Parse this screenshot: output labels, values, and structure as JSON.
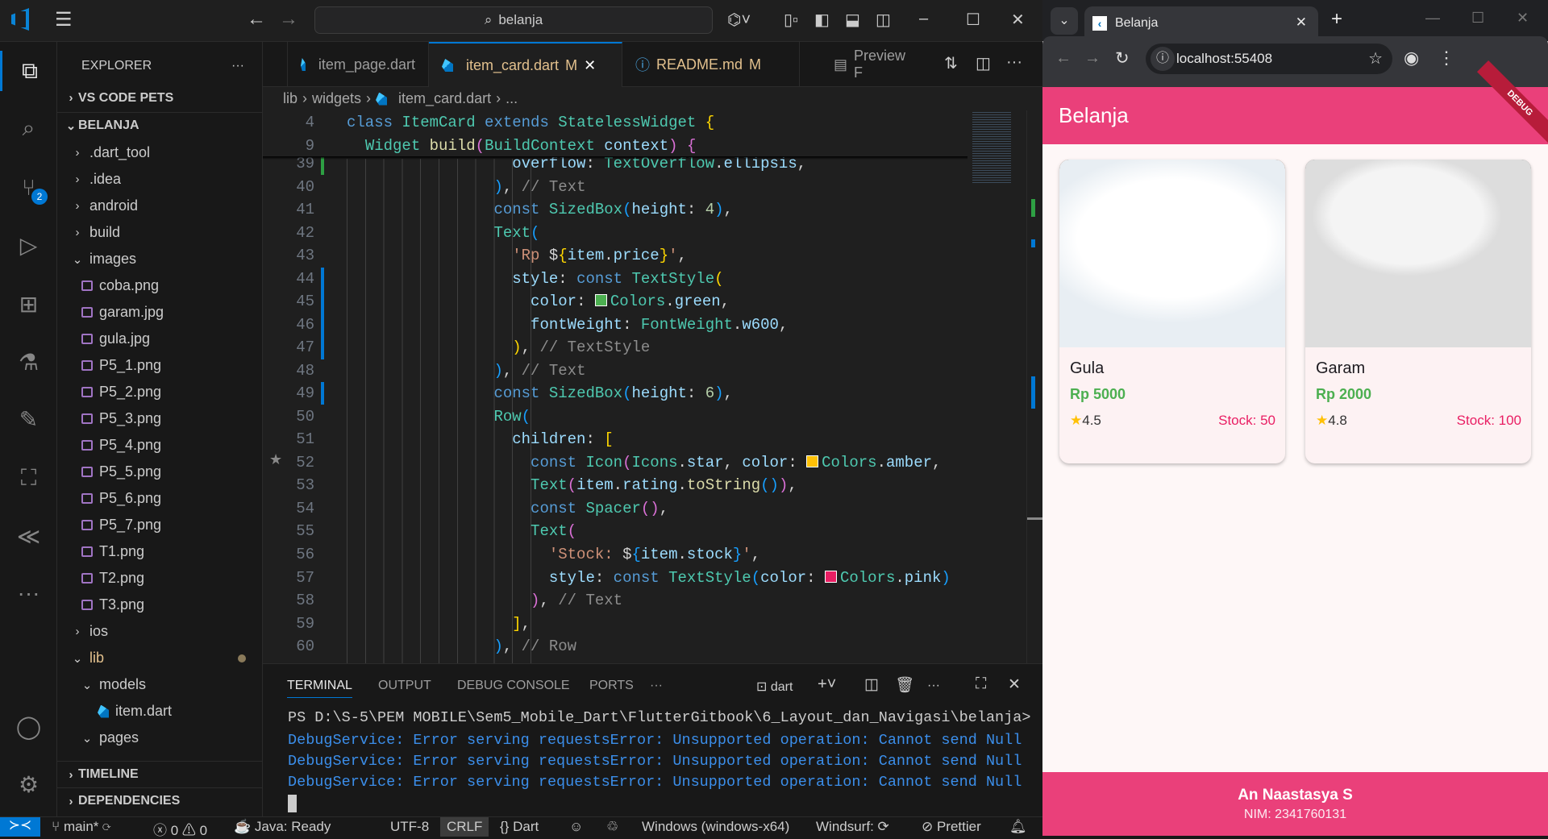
{
  "titlebar": {
    "search": "belanja",
    "nav_back": "←",
    "nav_forward": "→",
    "menu": "☰"
  },
  "activity": {
    "scm_badge": "2"
  },
  "sidebar": {
    "title": "EXPLORER",
    "more": "···",
    "sections": {
      "pets": "VS CODE PETS",
      "project": "BELANJA",
      "timeline": "TIMELINE",
      "dependencies": "DEPENDENCIES"
    },
    "tree": [
      {
        "label": ".dart_tool",
        "kind": "folder",
        "depth": 0,
        "open": false
      },
      {
        "label": ".idea",
        "kind": "folder",
        "depth": 0,
        "open": false
      },
      {
        "label": "android",
        "kind": "folder",
        "depth": 0,
        "open": false
      },
      {
        "label": "build",
        "kind": "folder",
        "depth": 0,
        "open": false
      },
      {
        "label": "images",
        "kind": "folder",
        "depth": 0,
        "open": true
      },
      {
        "label": "coba.png",
        "kind": "image",
        "depth": 1
      },
      {
        "label": "garam.jpg",
        "kind": "image",
        "depth": 1
      },
      {
        "label": "gula.jpg",
        "kind": "image",
        "depth": 1
      },
      {
        "label": "P5_1.png",
        "kind": "image",
        "depth": 1
      },
      {
        "label": "P5_2.png",
        "kind": "image",
        "depth": 1
      },
      {
        "label": "P5_3.png",
        "kind": "image",
        "depth": 1
      },
      {
        "label": "P5_4.png",
        "kind": "image",
        "depth": 1
      },
      {
        "label": "P5_5.png",
        "kind": "image",
        "depth": 1
      },
      {
        "label": "P5_6.png",
        "kind": "image",
        "depth": 1
      },
      {
        "label": "P5_7.png",
        "kind": "image",
        "depth": 1
      },
      {
        "label": "T1.png",
        "kind": "image",
        "depth": 1
      },
      {
        "label": "T2.png",
        "kind": "image",
        "depth": 1
      },
      {
        "label": "T3.png",
        "kind": "image",
        "depth": 1
      },
      {
        "label": "ios",
        "kind": "folder",
        "depth": 0,
        "open": false
      },
      {
        "label": "lib",
        "kind": "folder",
        "depth": 0,
        "open": true,
        "modified": true
      },
      {
        "label": "models",
        "kind": "folder",
        "depth": 1,
        "open": true
      },
      {
        "label": "item.dart",
        "kind": "dart",
        "depth": 2
      },
      {
        "label": "pages",
        "kind": "folder",
        "depth": 1,
        "open": true
      }
    ]
  },
  "editor": {
    "tabs": [
      {
        "label": "item_page.dart",
        "status": "",
        "icon": "dart"
      },
      {
        "label": "item_card.dart",
        "status": "M",
        "icon": "dart",
        "active": true
      },
      {
        "label": "README.md",
        "status": "M",
        "icon": "info"
      },
      {
        "label": "Preview F",
        "status": "",
        "icon": "preview"
      }
    ],
    "breadcrumb": [
      "lib",
      "widgets",
      "item_card.dart",
      "..."
    ],
    "sticky": [
      {
        "n": "4",
        "tokens": [
          [
            "kw",
            "class "
          ],
          [
            "cls",
            "ItemCard "
          ],
          [
            "kw",
            "extends "
          ],
          [
            "cls",
            "StatelessWidget "
          ],
          [
            "b1",
            "{"
          ]
        ]
      },
      {
        "n": "9",
        "tokens": [
          [
            "p",
            "  "
          ],
          [
            "cls",
            "Widget "
          ],
          [
            "fn",
            "build"
          ],
          [
            "b2",
            "("
          ],
          [
            "cls",
            "BuildContext "
          ],
          [
            "prop",
            "context"
          ],
          [
            "b2",
            ")"
          ],
          [
            "p",
            " "
          ],
          [
            "b2",
            "{"
          ]
        ]
      }
    ],
    "lines": [
      {
        "n": "39",
        "tokens": [
          [
            "p",
            "                  "
          ],
          [
            "prop",
            "overflow"
          ],
          [
            "p",
            ": "
          ],
          [
            "cls",
            "TextOverflow"
          ],
          [
            "p",
            "."
          ],
          [
            "prop",
            "ellipsis"
          ],
          [
            "p",
            ","
          ]
        ]
      },
      {
        "n": "40",
        "tokens": [
          [
            "p",
            "                "
          ],
          [
            "b3",
            ")"
          ],
          [
            "p",
            ", "
          ],
          [
            "cm",
            "// Text"
          ]
        ]
      },
      {
        "n": "41",
        "tokens": [
          [
            "p",
            "                "
          ],
          [
            "kw",
            "const "
          ],
          [
            "cls",
            "SizedBox"
          ],
          [
            "b3",
            "("
          ],
          [
            "prop",
            "height"
          ],
          [
            "p",
            ": "
          ],
          [
            "num",
            "4"
          ],
          [
            "b3",
            ")"
          ],
          [
            "p",
            ","
          ]
        ]
      },
      {
        "n": "42",
        "tokens": [
          [
            "p",
            "                "
          ],
          [
            "cls",
            "Text"
          ],
          [
            "b3",
            "("
          ]
        ]
      },
      {
        "n": "43",
        "tokens": [
          [
            "p",
            "                  "
          ],
          [
            "str",
            "'Rp "
          ],
          [
            "p",
            "$"
          ],
          [
            "b1",
            "{"
          ],
          [
            "prop",
            "item"
          ],
          [
            "p",
            "."
          ],
          [
            "prop",
            "price"
          ],
          [
            "b1",
            "}"
          ],
          [
            "str",
            "'"
          ],
          [
            "p",
            ","
          ]
        ]
      },
      {
        "n": "44",
        "tokens": [
          [
            "p",
            "                  "
          ],
          [
            "prop",
            "style"
          ],
          [
            "p",
            ": "
          ],
          [
            "kw",
            "const "
          ],
          [
            "cls",
            "TextStyle"
          ],
          [
            "b1",
            "("
          ]
        ]
      },
      {
        "n": "45",
        "tokens": [
          [
            "p",
            "                    "
          ],
          [
            "prop",
            "color"
          ],
          [
            "p",
            ": "
          ],
          [
            "sw",
            "#4caf50"
          ],
          [
            "cls",
            "Colors"
          ],
          [
            "p",
            "."
          ],
          [
            "prop",
            "green"
          ],
          [
            "p",
            ","
          ]
        ]
      },
      {
        "n": "46",
        "tokens": [
          [
            "p",
            "                    "
          ],
          [
            "prop",
            "fontWeight"
          ],
          [
            "p",
            ": "
          ],
          [
            "cls",
            "FontWeight"
          ],
          [
            "p",
            "."
          ],
          [
            "prop",
            "w600"
          ],
          [
            "p",
            ","
          ]
        ]
      },
      {
        "n": "47",
        "tokens": [
          [
            "p",
            "                  "
          ],
          [
            "b1",
            ")"
          ],
          [
            "p",
            ", "
          ],
          [
            "cm",
            "// TextStyle"
          ]
        ]
      },
      {
        "n": "48",
        "tokens": [
          [
            "p",
            "                "
          ],
          [
            "b3",
            ")"
          ],
          [
            "p",
            ", "
          ],
          [
            "cm",
            "// Text"
          ]
        ]
      },
      {
        "n": "49",
        "tokens": [
          [
            "p",
            "                "
          ],
          [
            "kw",
            "const "
          ],
          [
            "cls",
            "SizedBox"
          ],
          [
            "b3",
            "("
          ],
          [
            "prop",
            "height"
          ],
          [
            "p",
            ": "
          ],
          [
            "num",
            "6"
          ],
          [
            "b3",
            ")"
          ],
          [
            "p",
            ","
          ]
        ]
      },
      {
        "n": "50",
        "tokens": [
          [
            "p",
            "                "
          ],
          [
            "cls",
            "Row"
          ],
          [
            "b3",
            "("
          ]
        ]
      },
      {
        "n": "51",
        "tokens": [
          [
            "p",
            "                  "
          ],
          [
            "prop",
            "children"
          ],
          [
            "p",
            ": "
          ],
          [
            "b1",
            "["
          ]
        ]
      },
      {
        "n": "52",
        "tokens": [
          [
            "p",
            "                    "
          ],
          [
            "kw",
            "const "
          ],
          [
            "cls",
            "Icon"
          ],
          [
            "b2",
            "("
          ],
          [
            "cls",
            "Icons"
          ],
          [
            "p",
            "."
          ],
          [
            "prop",
            "star"
          ],
          [
            "p",
            ", "
          ],
          [
            "prop",
            "color"
          ],
          [
            "p",
            ": "
          ],
          [
            "sw",
            "#ffc107"
          ],
          [
            "cls",
            "Colors"
          ],
          [
            "p",
            "."
          ],
          [
            "prop",
            "amber"
          ],
          [
            "p",
            ", "
          ]
        ]
      },
      {
        "n": "53",
        "tokens": [
          [
            "p",
            "                    "
          ],
          [
            "cls",
            "Text"
          ],
          [
            "b2",
            "("
          ],
          [
            "prop",
            "item"
          ],
          [
            "p",
            "."
          ],
          [
            "prop",
            "rating"
          ],
          [
            "p",
            "."
          ],
          [
            "fn",
            "toString"
          ],
          [
            "b3",
            "()"
          ],
          [
            "b2",
            ")"
          ],
          [
            "p",
            ","
          ]
        ]
      },
      {
        "n": "54",
        "tokens": [
          [
            "p",
            "                    "
          ],
          [
            "kw",
            "const "
          ],
          [
            "cls",
            "Spacer"
          ],
          [
            "b2",
            "()"
          ],
          [
            "p",
            ","
          ]
        ]
      },
      {
        "n": "55",
        "tokens": [
          [
            "p",
            "                    "
          ],
          [
            "cls",
            "Text"
          ],
          [
            "b2",
            "("
          ]
        ]
      },
      {
        "n": "56",
        "tokens": [
          [
            "p",
            "                      "
          ],
          [
            "str",
            "'Stock: "
          ],
          [
            "p",
            "$"
          ],
          [
            "b3",
            "{"
          ],
          [
            "prop",
            "item"
          ],
          [
            "p",
            "."
          ],
          [
            "prop",
            "stock"
          ],
          [
            "b3",
            "}"
          ],
          [
            "str",
            "'"
          ],
          [
            "p",
            ","
          ]
        ]
      },
      {
        "n": "57",
        "tokens": [
          [
            "p",
            "                      "
          ],
          [
            "prop",
            "style"
          ],
          [
            "p",
            ": "
          ],
          [
            "kw",
            "const "
          ],
          [
            "cls",
            "TextStyle"
          ],
          [
            "b3",
            "("
          ],
          [
            "prop",
            "color"
          ],
          [
            "p",
            ": "
          ],
          [
            "sw",
            "#e91e63"
          ],
          [
            "cls",
            "Colors"
          ],
          [
            "p",
            "."
          ],
          [
            "prop",
            "pink"
          ],
          [
            "b3",
            ")"
          ]
        ]
      },
      {
        "n": "58",
        "tokens": [
          [
            "p",
            "                    "
          ],
          [
            "b2",
            ")"
          ],
          [
            "p",
            ", "
          ],
          [
            "cm",
            "// Text"
          ]
        ]
      },
      {
        "n": "59",
        "tokens": [
          [
            "p",
            "                  "
          ],
          [
            "b1",
            "]"
          ],
          [
            "p",
            ","
          ]
        ]
      },
      {
        "n": "60",
        "tokens": [
          [
            "p",
            "                "
          ],
          [
            "b3",
            ")"
          ],
          [
            "p",
            ", "
          ],
          [
            "cm",
            "// Row"
          ]
        ]
      }
    ]
  },
  "panel": {
    "tabs": [
      "TERMINAL",
      "OUTPUT",
      "DEBUG CONSOLE",
      "PORTS"
    ],
    "more": "···",
    "shell": "dart",
    "lines": [
      "PS D:\\S-5\\PEM MOBILE\\Sem5_Mobile_Dart\\FlutterGitbook\\6_Layout_dan_Navigasi\\belanja>",
      "DebugService: Error serving requestsError: Unsupported operation: Cannot send Null",
      "DebugService: Error serving requestsError: Unsupported operation: Cannot send Null",
      "DebugService: Error serving requestsError: Unsupported operation: Cannot send Null"
    ]
  },
  "status": {
    "branch": "main*",
    "errors": "0",
    "warnings": "0",
    "java": "Java: Ready",
    "encoding": "UTF-8",
    "eol": "CRLF",
    "language": "Dart",
    "platform": "Windows (windows-x64)",
    "windsurf": "Windsurf:",
    "prettier": "Prettier"
  },
  "browser": {
    "tab_title": "Belanja",
    "url": "localhost:55408",
    "app": {
      "title": "Belanja",
      "debug_banner": "DEBUG",
      "items": [
        {
          "name": "Gula",
          "price": "Rp 5000",
          "rating": "4.5",
          "stock": "Stock: 50",
          "image": "sugar"
        },
        {
          "name": "Garam",
          "price": "Rp 2000",
          "rating": "4.8",
          "stock": "Stock: 100",
          "image": "salt"
        }
      ],
      "footer": {
        "name": "An Naastasya S",
        "nim": "NIM: 2341760131"
      }
    },
    "colors": {
      "primary": "#ea407a",
      "price": "#4caf50",
      "stock": "#e91e63",
      "star": "#ffc107"
    }
  }
}
